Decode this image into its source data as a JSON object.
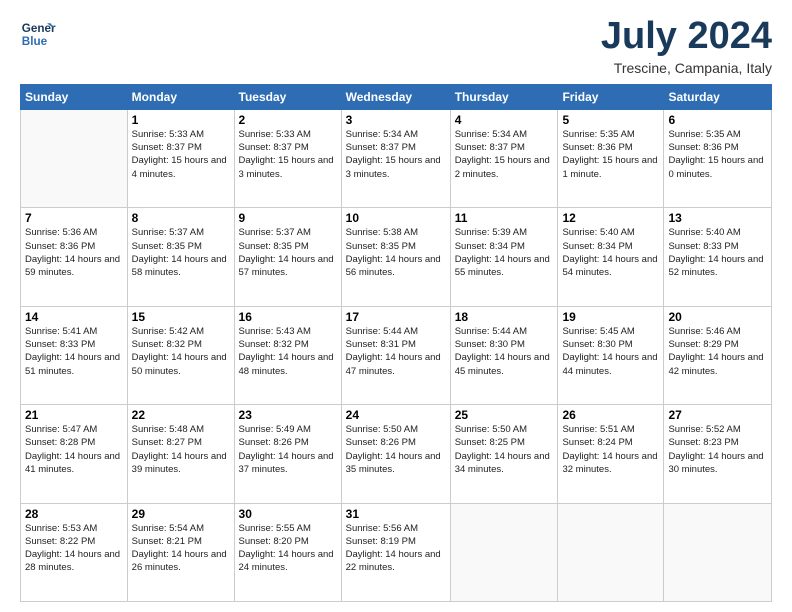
{
  "logo": {
    "line1": "General",
    "line2": "Blue"
  },
  "title": "July 2024",
  "subtitle": "Trescine, Campania, Italy",
  "headers": [
    "Sunday",
    "Monday",
    "Tuesday",
    "Wednesday",
    "Thursday",
    "Friday",
    "Saturday"
  ],
  "weeks": [
    [
      {
        "day": "",
        "sunrise": "",
        "sunset": "",
        "daylight": "",
        "empty": true
      },
      {
        "day": "1",
        "sunrise": "Sunrise: 5:33 AM",
        "sunset": "Sunset: 8:37 PM",
        "daylight": "Daylight: 15 hours and 4 minutes."
      },
      {
        "day": "2",
        "sunrise": "Sunrise: 5:33 AM",
        "sunset": "Sunset: 8:37 PM",
        "daylight": "Daylight: 15 hours and 3 minutes."
      },
      {
        "day": "3",
        "sunrise": "Sunrise: 5:34 AM",
        "sunset": "Sunset: 8:37 PM",
        "daylight": "Daylight: 15 hours and 3 minutes."
      },
      {
        "day": "4",
        "sunrise": "Sunrise: 5:34 AM",
        "sunset": "Sunset: 8:37 PM",
        "daylight": "Daylight: 15 hours and 2 minutes."
      },
      {
        "day": "5",
        "sunrise": "Sunrise: 5:35 AM",
        "sunset": "Sunset: 8:36 PM",
        "daylight": "Daylight: 15 hours and 1 minute."
      },
      {
        "day": "6",
        "sunrise": "Sunrise: 5:35 AM",
        "sunset": "Sunset: 8:36 PM",
        "daylight": "Daylight: 15 hours and 0 minutes."
      }
    ],
    [
      {
        "day": "7",
        "sunrise": "Sunrise: 5:36 AM",
        "sunset": "Sunset: 8:36 PM",
        "daylight": "Daylight: 14 hours and 59 minutes."
      },
      {
        "day": "8",
        "sunrise": "Sunrise: 5:37 AM",
        "sunset": "Sunset: 8:35 PM",
        "daylight": "Daylight: 14 hours and 58 minutes."
      },
      {
        "day": "9",
        "sunrise": "Sunrise: 5:37 AM",
        "sunset": "Sunset: 8:35 PM",
        "daylight": "Daylight: 14 hours and 57 minutes."
      },
      {
        "day": "10",
        "sunrise": "Sunrise: 5:38 AM",
        "sunset": "Sunset: 8:35 PM",
        "daylight": "Daylight: 14 hours and 56 minutes."
      },
      {
        "day": "11",
        "sunrise": "Sunrise: 5:39 AM",
        "sunset": "Sunset: 8:34 PM",
        "daylight": "Daylight: 14 hours and 55 minutes."
      },
      {
        "day": "12",
        "sunrise": "Sunrise: 5:40 AM",
        "sunset": "Sunset: 8:34 PM",
        "daylight": "Daylight: 14 hours and 54 minutes."
      },
      {
        "day": "13",
        "sunrise": "Sunrise: 5:40 AM",
        "sunset": "Sunset: 8:33 PM",
        "daylight": "Daylight: 14 hours and 52 minutes."
      }
    ],
    [
      {
        "day": "14",
        "sunrise": "Sunrise: 5:41 AM",
        "sunset": "Sunset: 8:33 PM",
        "daylight": "Daylight: 14 hours and 51 minutes."
      },
      {
        "day": "15",
        "sunrise": "Sunrise: 5:42 AM",
        "sunset": "Sunset: 8:32 PM",
        "daylight": "Daylight: 14 hours and 50 minutes."
      },
      {
        "day": "16",
        "sunrise": "Sunrise: 5:43 AM",
        "sunset": "Sunset: 8:32 PM",
        "daylight": "Daylight: 14 hours and 48 minutes."
      },
      {
        "day": "17",
        "sunrise": "Sunrise: 5:44 AM",
        "sunset": "Sunset: 8:31 PM",
        "daylight": "Daylight: 14 hours and 47 minutes."
      },
      {
        "day": "18",
        "sunrise": "Sunrise: 5:44 AM",
        "sunset": "Sunset: 8:30 PM",
        "daylight": "Daylight: 14 hours and 45 minutes."
      },
      {
        "day": "19",
        "sunrise": "Sunrise: 5:45 AM",
        "sunset": "Sunset: 8:30 PM",
        "daylight": "Daylight: 14 hours and 44 minutes."
      },
      {
        "day": "20",
        "sunrise": "Sunrise: 5:46 AM",
        "sunset": "Sunset: 8:29 PM",
        "daylight": "Daylight: 14 hours and 42 minutes."
      }
    ],
    [
      {
        "day": "21",
        "sunrise": "Sunrise: 5:47 AM",
        "sunset": "Sunset: 8:28 PM",
        "daylight": "Daylight: 14 hours and 41 minutes."
      },
      {
        "day": "22",
        "sunrise": "Sunrise: 5:48 AM",
        "sunset": "Sunset: 8:27 PM",
        "daylight": "Daylight: 14 hours and 39 minutes."
      },
      {
        "day": "23",
        "sunrise": "Sunrise: 5:49 AM",
        "sunset": "Sunset: 8:26 PM",
        "daylight": "Daylight: 14 hours and 37 minutes."
      },
      {
        "day": "24",
        "sunrise": "Sunrise: 5:50 AM",
        "sunset": "Sunset: 8:26 PM",
        "daylight": "Daylight: 14 hours and 35 minutes."
      },
      {
        "day": "25",
        "sunrise": "Sunrise: 5:50 AM",
        "sunset": "Sunset: 8:25 PM",
        "daylight": "Daylight: 14 hours and 34 minutes."
      },
      {
        "day": "26",
        "sunrise": "Sunrise: 5:51 AM",
        "sunset": "Sunset: 8:24 PM",
        "daylight": "Daylight: 14 hours and 32 minutes."
      },
      {
        "day": "27",
        "sunrise": "Sunrise: 5:52 AM",
        "sunset": "Sunset: 8:23 PM",
        "daylight": "Daylight: 14 hours and 30 minutes."
      }
    ],
    [
      {
        "day": "28",
        "sunrise": "Sunrise: 5:53 AM",
        "sunset": "Sunset: 8:22 PM",
        "daylight": "Daylight: 14 hours and 28 minutes."
      },
      {
        "day": "29",
        "sunrise": "Sunrise: 5:54 AM",
        "sunset": "Sunset: 8:21 PM",
        "daylight": "Daylight: 14 hours and 26 minutes."
      },
      {
        "day": "30",
        "sunrise": "Sunrise: 5:55 AM",
        "sunset": "Sunset: 8:20 PM",
        "daylight": "Daylight: 14 hours and 24 minutes."
      },
      {
        "day": "31",
        "sunrise": "Sunrise: 5:56 AM",
        "sunset": "Sunset: 8:19 PM",
        "daylight": "Daylight: 14 hours and 22 minutes."
      },
      {
        "day": "",
        "sunrise": "",
        "sunset": "",
        "daylight": "",
        "empty": true
      },
      {
        "day": "",
        "sunrise": "",
        "sunset": "",
        "daylight": "",
        "empty": true
      },
      {
        "day": "",
        "sunrise": "",
        "sunset": "",
        "daylight": "",
        "empty": true
      }
    ]
  ]
}
